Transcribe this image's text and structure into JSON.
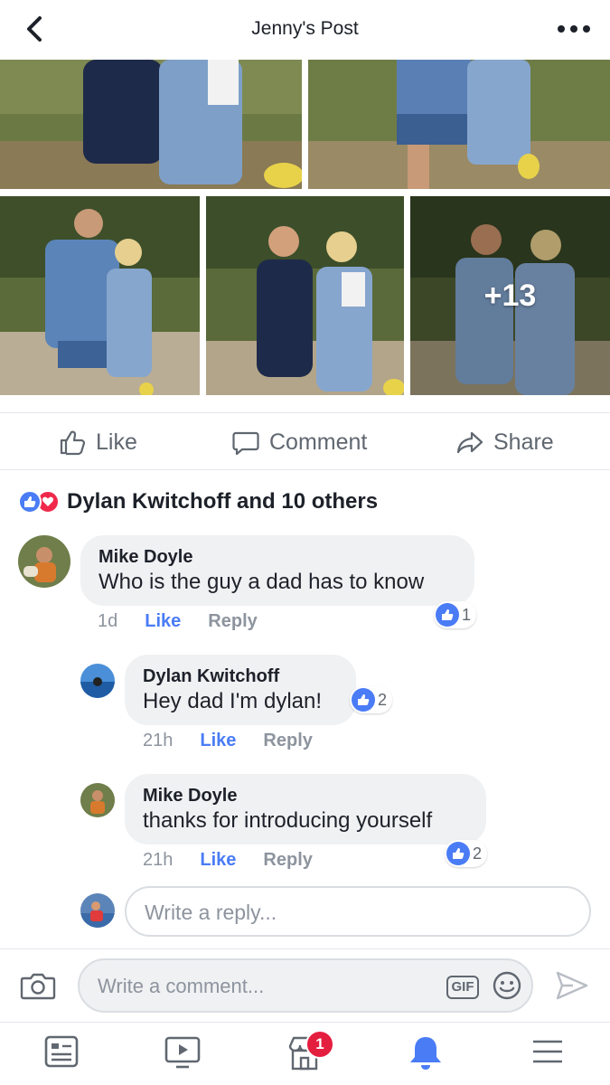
{
  "header": {
    "title": "Jenny's Post"
  },
  "photos": {
    "more_count": "+13"
  },
  "actions": {
    "like": "Like",
    "comment": "Comment",
    "share": "Share"
  },
  "reactions": {
    "summary": "Dylan Kwitchoff and 10 others"
  },
  "comments": [
    {
      "name": "Mike Doyle",
      "text": "Who is the guy a dad has to know",
      "time": "1d",
      "like": "Like",
      "reply": "Reply",
      "reaction_count": "1"
    },
    {
      "name": "Dylan Kwitchoff",
      "text": "Hey dad I'm dylan!",
      "time": "21h",
      "like": "Like",
      "reply": "Reply",
      "reaction_count": "2"
    },
    {
      "name": "Mike Doyle",
      "text": "thanks for introducing yourself",
      "time": "21h",
      "like": "Like",
      "reply": "Reply",
      "reaction_count": "2"
    }
  ],
  "reply_input": {
    "placeholder": "Write a reply..."
  },
  "comment_bar": {
    "placeholder": "Write a comment...",
    "gif_label": "GIF"
  },
  "tabbar": {
    "notifications_badge": "1"
  },
  "colors": {
    "accent": "#4a7cf6",
    "love": "#f0284a",
    "badge": "#e41e3f",
    "bubble": "#f0f1f3",
    "muted": "#8d949e"
  }
}
